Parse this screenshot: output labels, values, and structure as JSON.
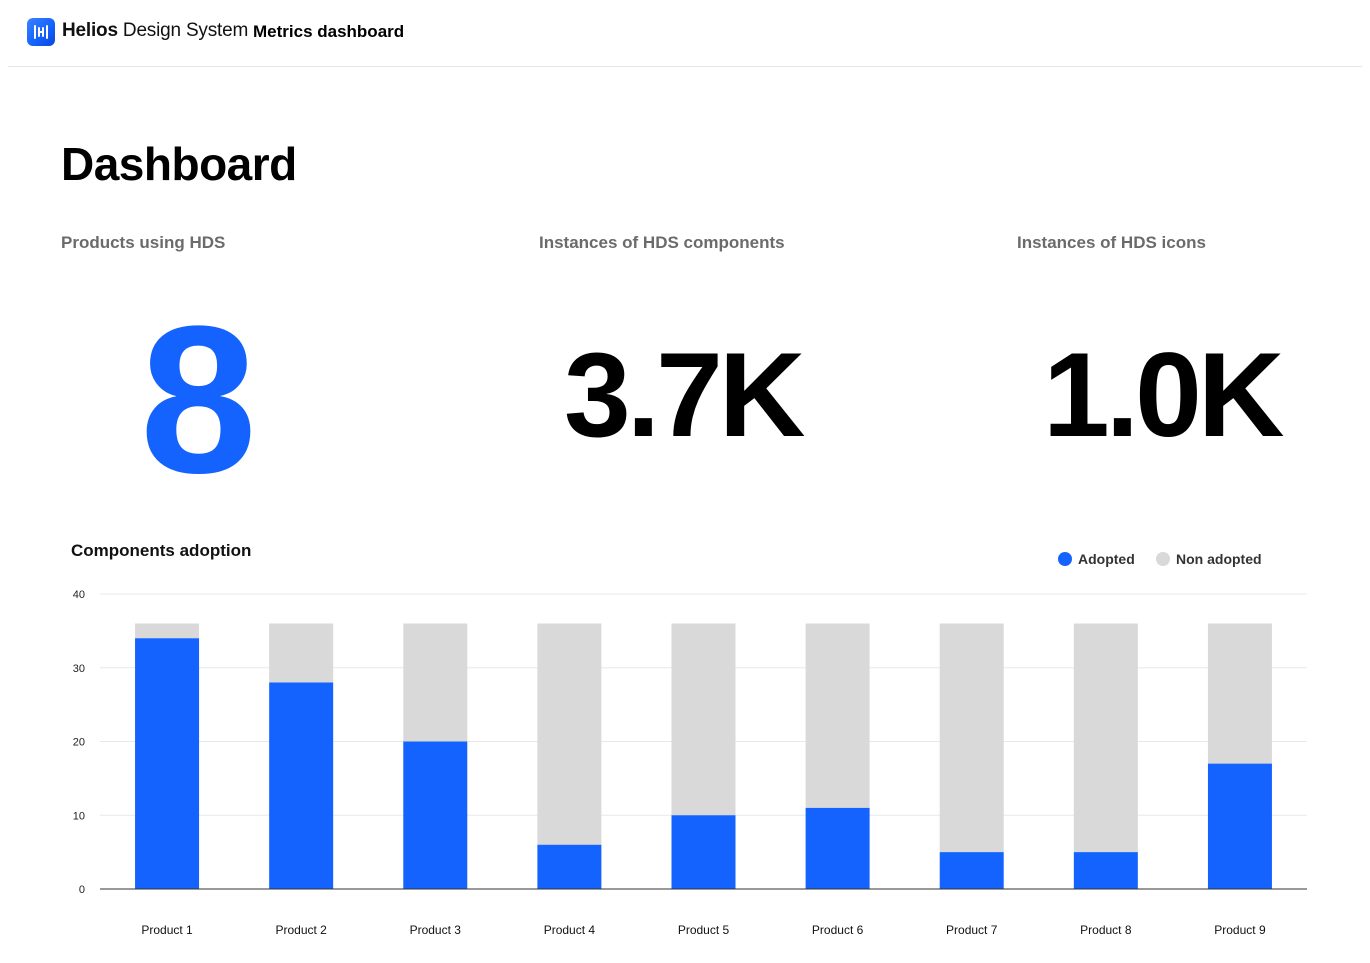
{
  "header": {
    "brand_bold": "Helios",
    "brand_light": "Design System",
    "subtitle": "Metrics dashboard"
  },
  "page": {
    "title": "Dashboard"
  },
  "metrics": [
    {
      "label": "Products using HDS",
      "value": "8",
      "color": "#1563ff"
    },
    {
      "label": "Instances of HDS components",
      "value": "3.7K",
      "color": "#000000"
    },
    {
      "label": "Instances of HDS icons",
      "value": "1.0K",
      "color": "#000000"
    }
  ],
  "colors": {
    "adopted": "#1563ff",
    "non_adopted": "#d9d9d9",
    "gridline": "#e8e8e8",
    "axis": "#333333"
  },
  "chart_data": {
    "type": "bar",
    "stacked": true,
    "title": "Components adoption",
    "legend_position": "top-right",
    "grid": true,
    "ylim": [
      0,
      40
    ],
    "yticks": [
      0,
      10,
      20,
      30,
      40
    ],
    "categories": [
      "Product 1",
      "Product 2",
      "Product 3",
      "Product 4",
      "Product 5",
      "Product 6",
      "Product 7",
      "Product 8",
      "Product 9"
    ],
    "series": [
      {
        "name": "Adopted",
        "values": [
          34,
          28,
          20,
          6,
          10,
          11,
          5,
          5,
          17
        ]
      },
      {
        "name": "Non adopted",
        "values": [
          2,
          8,
          16,
          30,
          26,
          25,
          31,
          31,
          19
        ]
      }
    ]
  }
}
